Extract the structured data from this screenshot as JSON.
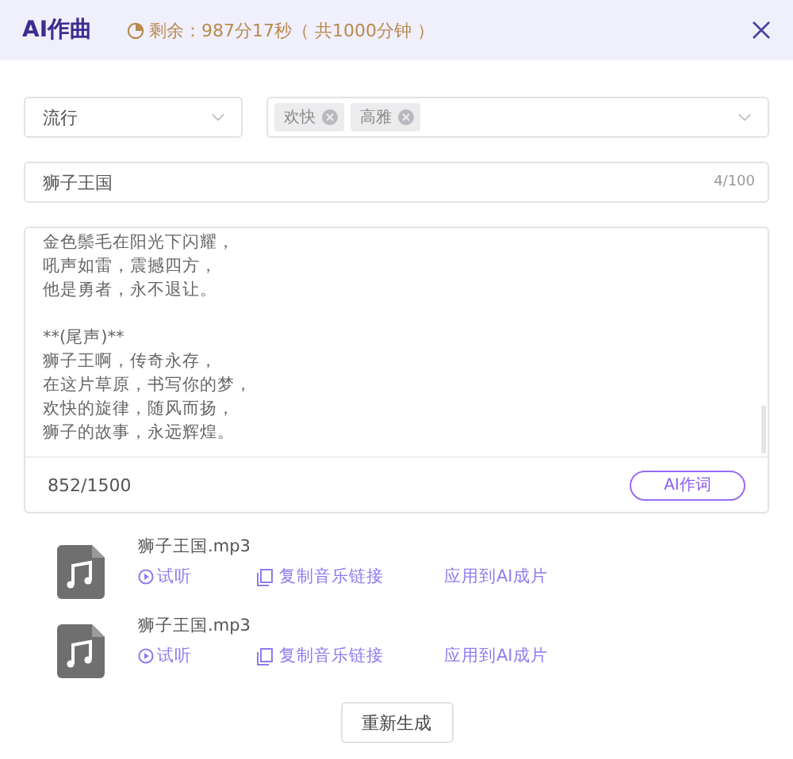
{
  "dialog": {
    "title": "AI作曲",
    "quota": "剩余：987分17秒（ 共1000分钟 ）"
  },
  "style_select": {
    "value": "流行"
  },
  "mood_select": {
    "tags": [
      "欢快",
      "高雅"
    ]
  },
  "title_field": {
    "value": "狮子王国",
    "counter": "4/100"
  },
  "lyrics": {
    "stanzas": [
      [
        "金色鬃毛在阳光下闪耀，",
        "吼声如雷，震撼四方，",
        "他是勇者，永不退让。"
      ],
      [
        "**(尾声)**",
        "狮子王啊，传奇永存，",
        "在这片草原，书写你的梦，",
        "欢快的旋律，随风而扬，",
        "狮子的故事，永远辉煌。"
      ]
    ],
    "counter": "852/1500",
    "button": "AI作词"
  },
  "files": [
    {
      "name": "狮子王国.mp3",
      "actions": [
        "试听",
        "复制音乐链接",
        "应用到AI成片"
      ]
    },
    {
      "name": "狮子王国.mp3",
      "actions": [
        "试听",
        "复制音乐链接",
        "应用到AI成片"
      ]
    }
  ],
  "regenerate_button": "重新生成"
}
